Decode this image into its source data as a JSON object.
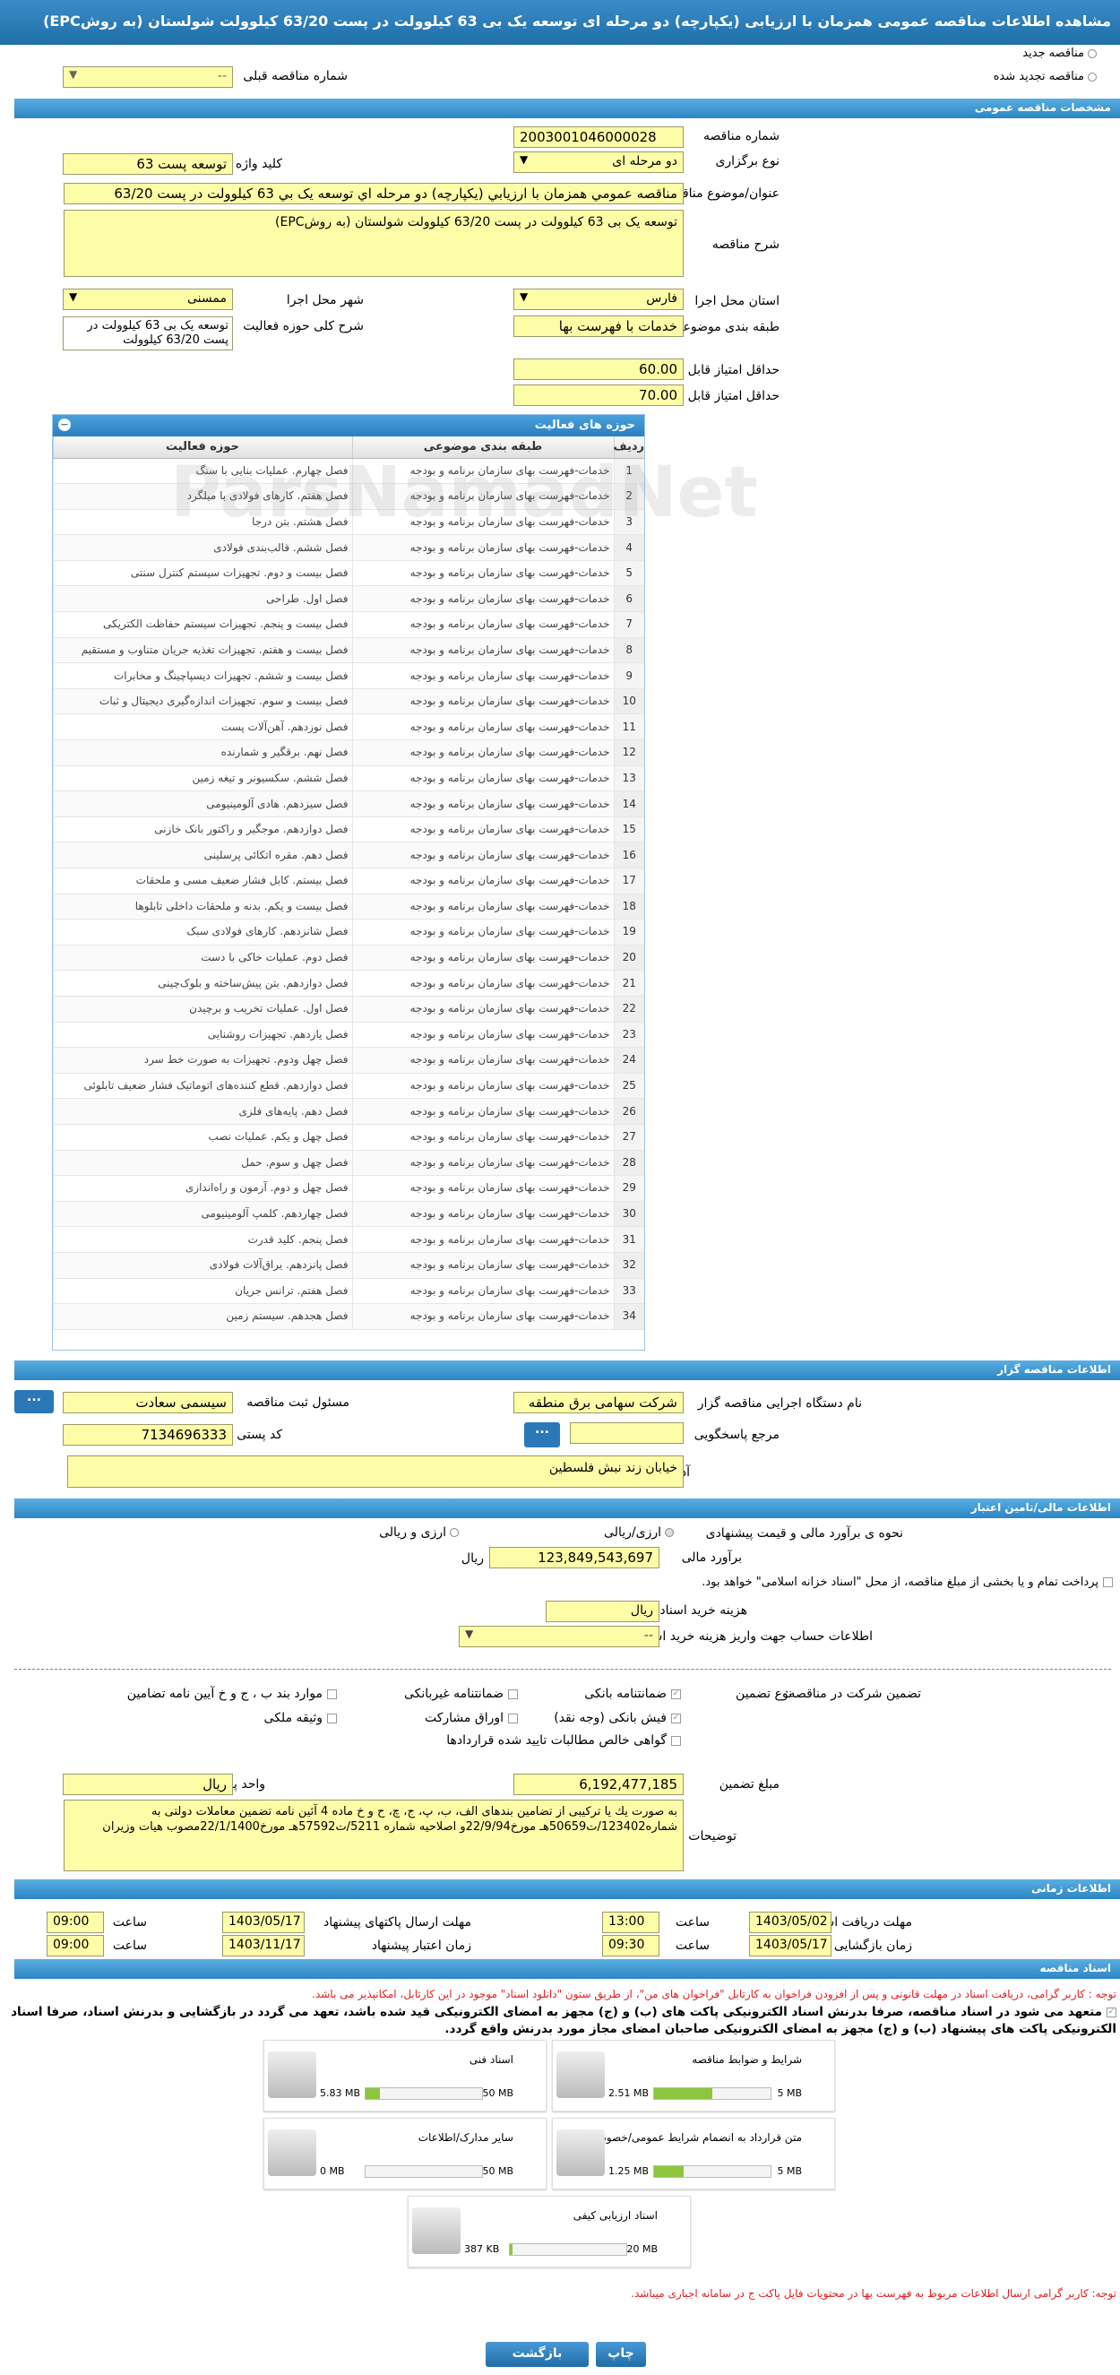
{
  "title": "مشاهده اطلاعات مناقصه عمومی همزمان با ارزیابی (یکپارچه) دو مرحله ای توسعه یک بی 63 کیلوولت در پست 63/20 کیلوولت شولستان (به روشEPC)",
  "top": {
    "new_tender": "مناقصه جدید",
    "renewed_tender": "مناقصه تجدید شده",
    "previous_number_label": "شماره مناقصه قبلی",
    "previous_number_value": "--"
  },
  "general": {
    "header": "مشخصات مناقصه عمومی",
    "number_label": "شماره مناقصه",
    "number_value": "2003001046000028",
    "type_label": "نوع برگزاری",
    "type_value": "دو مرحله ای",
    "keyword_label": "کلید واژه",
    "keyword_value": "توسعه پست 63",
    "subject_label": "عنوان/موضوع مناقصه",
    "subject_value": "مناقصه عمومي همزمان با ارزيابي (يکپارچه) دو مرحله اي توسعه يک بي 63 کيلوولت در پست 63/20",
    "desc_label": "شرح مناقصه",
    "desc_value": "توسعه یک بی 63 کیلوولت در پست 63/20 کیلوولت شولستان (به روشEPC)",
    "province_label": "استان محل اجرا",
    "province_value": "فارس",
    "city_label": "شهر محل اجرا",
    "city_value": "ممسنی",
    "category_label": "طبقه بندی موضوعی",
    "category_value": "خدمات با فهرست بها",
    "scope_label": "شرح کلی حوزه فعالیت",
    "scope_value": "توسعه یک بی 63 کیلوولت در پست 63/20 کیلوولت",
    "quality_label": "حداقل امتیاز قابل قبول ارزیابی کیفی",
    "quality_value": "60.00",
    "tech_label": "حداقل امتیاز قابل قبول ارزیابی فنی/بازرگانی",
    "tech_value": "70.00"
  },
  "activities": {
    "header": "حوزه های فعالیت",
    "col_row": "ردیف",
    "col_category": "طبقه بندی موضوعی",
    "col_field": "حوزه فعالیت",
    "rows": [
      {
        "n": "1",
        "cat": "خدمات-فهرست بهای سازمان برنامه و بودجه",
        "field": "فصل چهارم. عملیات بنایی با سنگ"
      },
      {
        "n": "2",
        "cat": "خدمات-فهرست بهای سازمان برنامه و بودجه",
        "field": "فصل هفتم. کارهای فولادی با میلگرد"
      },
      {
        "n": "3",
        "cat": "خدمات-فهرست بهای سازمان برنامه و بودجه",
        "field": "فصل هشتم. بتن درجا"
      },
      {
        "n": "4",
        "cat": "خدمات-فهرست بهای سازمان برنامه و بودجه",
        "field": "فصل ششم. قالب‌بندی فولادی"
      },
      {
        "n": "5",
        "cat": "خدمات-فهرست بهای سازمان برنامه و بودجه",
        "field": "فصل بیست و دوم. تجهیزات سیستم کنترل سنتی"
      },
      {
        "n": "6",
        "cat": "خدمات-فهرست بهای سازمان برنامه و بودجه",
        "field": "فصل اول. طراحی"
      },
      {
        "n": "7",
        "cat": "خدمات-فهرست بهای سازمان برنامه و بودجه",
        "field": "فصل بیست و پنجم. تجهیزات سیستم حفاظت الکتریکی"
      },
      {
        "n": "8",
        "cat": "خدمات-فهرست بهای سازمان برنامه و بودجه",
        "field": "فصل بیست و هفتم. تجهیزات تغذیه جریان متناوب و مستقیم"
      },
      {
        "n": "9",
        "cat": "خدمات-فهرست بهای سازمان برنامه و بودجه",
        "field": "فصل بیست و ششم. تجهیزات دیسپاچینگ و مخابرات"
      },
      {
        "n": "10",
        "cat": "خدمات-فهرست بهای سازمان برنامه و بودجه",
        "field": "فصل بیست و سوم. تجهیزات اندازه‌گیری دیجیتال و ثبات"
      },
      {
        "n": "11",
        "cat": "خدمات-فهرست بهای سازمان برنامه و بودجه",
        "field": "فصل نوزدهم. آهن‌آلات پست"
      },
      {
        "n": "12",
        "cat": "خدمات-فهرست بهای سازمان برنامه و بودجه",
        "field": "فصل نهم. برقگیر و شمارنده"
      },
      {
        "n": "13",
        "cat": "خدمات-فهرست بهای سازمان برنامه و بودجه",
        "field": "فصل ششم. سکسیونر و تیغه زمین"
      },
      {
        "n": "14",
        "cat": "خدمات-فهرست بهای سازمان برنامه و بودجه",
        "field": "فصل سیزدهم. هادی آلومینیومی"
      },
      {
        "n": "15",
        "cat": "خدمات-فهرست بهای سازمان برنامه و بودجه",
        "field": "فصل دوازدهم. موجگیر و راکتور بانک خازنی"
      },
      {
        "n": "16",
        "cat": "خدمات-فهرست بهای سازمان برنامه و بودجه",
        "field": "فصل دهم. مقره اتکائی پرسلینی"
      },
      {
        "n": "17",
        "cat": "خدمات-فهرست بهای سازمان برنامه و بودجه",
        "field": "فصل بیستم. کابل فشار ضعیف مسی و ملحقات"
      },
      {
        "n": "18",
        "cat": "خدمات-فهرست بهای سازمان برنامه و بودجه",
        "field": "فصل بیست و یکم. بدنه و ملحقات داخلی تابلوها"
      },
      {
        "n": "19",
        "cat": "خدمات-فهرست بهای سازمان برنامه و بودجه",
        "field": "فصل شانزدهم. کارهای فولادی سبک"
      },
      {
        "n": "20",
        "cat": "خدمات-فهرست بهای سازمان برنامه و بودجه",
        "field": "فصل دوم. عملیات خاکی با دست"
      },
      {
        "n": "21",
        "cat": "خدمات-فهرست بهای سازمان برنامه و بودجه",
        "field": "فصل دوازدهم. بتن پیش‌ساخته و بلوک‌چینی"
      },
      {
        "n": "22",
        "cat": "خدمات-فهرست بهای سازمان برنامه و بودجه",
        "field": "فصل اول. عملیات تخریب و برچیدن"
      },
      {
        "n": "23",
        "cat": "خدمات-فهرست بهای سازمان برنامه و بودجه",
        "field": "فصل یازدهم. تجهیزات روشنایی"
      },
      {
        "n": "24",
        "cat": "خدمات-فهرست بهای سازمان برنامه و بودجه",
        "field": "فصل چهل ودوم. تجهیزات به صورت خط سرد"
      },
      {
        "n": "25",
        "cat": "خدمات-فهرست بهای سازمان برنامه و بودجه",
        "field": "فصل دوازدهم. قطع کننده‌های اتوماتیک فشار ضعیف تابلوئی"
      },
      {
        "n": "26",
        "cat": "خدمات-فهرست بهای سازمان برنامه و بودجه",
        "field": "فصل دهم. پایه‌های فلزی"
      },
      {
        "n": "27",
        "cat": "خدمات-فهرست بهای سازمان برنامه و بودجه",
        "field": "فصل چهل و یکم. عملیات نصب"
      },
      {
        "n": "28",
        "cat": "خدمات-فهرست بهای سازمان برنامه و بودجه",
        "field": "فصل چهل و سوم. حمل"
      },
      {
        "n": "29",
        "cat": "خدمات-فهرست بهای سازمان برنامه و بودجه",
        "field": "فصل چهل و دوم. آزمون و راه‌اندازی"
      },
      {
        "n": "30",
        "cat": "خدمات-فهرست بهای سازمان برنامه و بودجه",
        "field": "فصل چهاردهم. کلمپ آلومینیومی"
      },
      {
        "n": "31",
        "cat": "خدمات-فهرست بهای سازمان برنامه و بودجه",
        "field": "فصل پنجم. کلید قدرت"
      },
      {
        "n": "32",
        "cat": "خدمات-فهرست بهای سازمان برنامه و بودجه",
        "field": "فصل پانزدهم. یراق‌آلات فولادی"
      },
      {
        "n": "33",
        "cat": "خدمات-فهرست بهای سازمان برنامه و بودجه",
        "field": "فصل هفتم. ترانس جریان"
      },
      {
        "n": "34",
        "cat": "خدمات-فهرست بهای سازمان برنامه و بودجه",
        "field": "فصل هجدهم. سیستم زمین"
      }
    ]
  },
  "organizer": {
    "header": "اطلاعات مناقصه گزار",
    "org_label": "نام دستگاه اجرایی مناقصه گزار",
    "org_value": "شرکت سهامی برق منطقه",
    "officer_label": "مسئول ثبت مناقصه",
    "officer_value": "سیسمی سعادت",
    "ref_label": "مرجع پاسخگویی",
    "ref_value": "",
    "postal_label": "کد پستی",
    "postal_value": "7134696333",
    "address_label": "آدرس",
    "address_value": "خیابان زند نبش فلسطین",
    "more_btn": "..."
  },
  "finance": {
    "header": "اطلاعات مالی/تامین اعتبار",
    "method_label": "نحوه ی برآورد مالی و قیمت پیشنهادی",
    "opt_rial": "ارزی/ریالی",
    "opt_rial2": "ارزی و ریالی",
    "estimate_label": "برآورد مالی",
    "estimate_value": "123,849,543,697",
    "rial": "ریال",
    "treasury_note": "پرداخت تمام و یا بخشی از مبلغ مناقصه، از محل \"اسناد خزانه اسلامی\" خواهد بود.",
    "doc_cost_label": "هزینه خرید اسناد",
    "doc_cost_value": "ریال",
    "account_label": "اطلاعات حساب جهت واریز هزینه خرید اسناد",
    "account_value": "--",
    "guarantee_label": "تضمین شرکت در مناقصه:",
    "guarantee_type": "نوع تضمین",
    "g1": "ضمانتنامه بانکی",
    "g2": "ضمانتنامه غیربانکی",
    "g3": "موارد بند ب ، ج و خ آیین نامه تضامین",
    "g4": "فیش بانکی (وجه نقد)",
    "g5": "اوراق مشارکت",
    "g6": "وثیقه ملکی",
    "g7": "گواهی خالص مطالبات تایید شده قراردادها",
    "amount_label": "مبلغ تضمین",
    "amount_value": "6,192,477,185",
    "currency_label": "واحد پول",
    "currency_value": "ریال",
    "desc_label": "توضیحات",
    "desc_value": "به صورت یك یا تركیبی از تضامین بندهای الف، ب، پ، ج، چ، ح و خ ماده 4 آئین نامه تضمین معاملات دولتی به شماره123402/ت50659هـ مورخ22/9/94و اصلاحیه شماره 5211/ت57592هـ مورخ22/1/1400مصوب هیات وزیران"
  },
  "timing": {
    "header": "اطلاعات زمانی",
    "receive_label": "مهلت دریافت اسناد",
    "receive_date": "1403/05/02",
    "receive_time": "13:00",
    "send_label": "مهلت ارسال پاکتهای پیشنهاد",
    "send_date": "1403/05/17",
    "send_time": "09:00",
    "open_label": "زمان بازگشایی پاکت ها",
    "open_date": "1403/05/17",
    "open_time": "09:30",
    "valid_label": "زمان اعتبار پیشنهاد",
    "valid_date": "1403/11/17",
    "valid_time": "09:00",
    "time_label": "ساعت"
  },
  "documents": {
    "header": "اسناد مناقصه",
    "note1": "توجه : کاربر گرامی، دریافت اسناد در مهلت قانونی و پس از افزودن فراخوان به کارتابل \"فراخوان های من\"، از طریق ستون \"دانلود اسناد\" موجود در این کارتابل، امکانپذیر می باشد.",
    "note2": "متعهد می شود در اسناد مناقصه، صرفا بدرنش اسناد الکترونیکی پاکت های (ب) و (ج) مجهز به امضای الکترونیکی قید شده باشد، تعهد می گردد در بازگشایی و بدرنش اسناد، صرفا اسناد الکترونیکی پاکت های پیشنهاد (ب) و (ج) مجهز به امضای الکترونیکی صاحبان امضای مجاز مورد بدرنش واقع گردد.",
    "items": [
      {
        "title": "شرایط و ضوابط مناقصه",
        "size": "2.51 MB",
        "max": "5 MB",
        "pct": 0.5
      },
      {
        "title": "اسناد فنی",
        "size": "5.83 MB",
        "max": "50 MB",
        "pct": 0.12
      },
      {
        "title": "متن قرارداد به انضمام شرایط عمومی/خصوصی",
        "size": "1.25 MB",
        "max": "5 MB",
        "pct": 0.25
      },
      {
        "title": "سایر مدارک/اطلاعات",
        "size": "0 MB",
        "max": "50 MB",
        "pct": 0
      },
      {
        "title": "اسناد ارزیابی کیفی",
        "size": "387 KB",
        "max": "20 MB",
        "pct": 0.02
      }
    ],
    "note3": "توجه: کاربر گرامی ارسال اطلاعات مربوط به فهرست بها در محتویات فایل پاکت ج در سامانه اجباری میباشد."
  },
  "buttons": {
    "back": "بازگشت",
    "print": "چاپ"
  },
  "watermark": "ParsNamadNet"
}
